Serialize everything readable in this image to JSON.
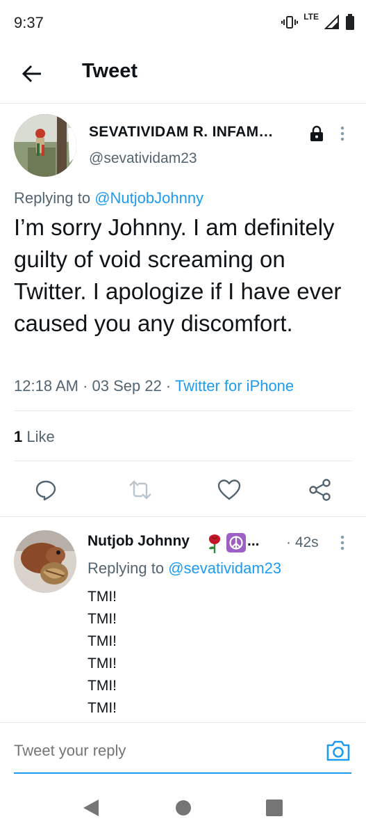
{
  "status_bar": {
    "time": "9:37",
    "network": "LTE"
  },
  "header": {
    "title": "Tweet"
  },
  "main_tweet": {
    "author_name": "SEVATIVIDAM R. INFAM…",
    "author_handle": "@sevatividam23",
    "protected": true,
    "replying_label": "Replying to ",
    "replying_mention": "@NutjobJohnny",
    "text": "I’m sorry Johnny. I am definitely guilty of void screaming on Twitter. I apologize if I have ever caused you any discomfort.",
    "meta_time": "12:18 AM · 03 Sep 22 · ",
    "meta_source": "Twitter for iPhone",
    "likes_count": "1",
    "likes_label": " Like"
  },
  "actions": [
    "reply-icon",
    "retweet-icon",
    "like-icon",
    "share-icon"
  ],
  "reply_tweet": {
    "author_name": "Nutjob Johnny",
    "name_ellipsis": "...",
    "time": "· 42s",
    "replying_label": "Replying to ",
    "replying_mention": "@sevatividam23",
    "lines": [
      "TMI!",
      "TMI!",
      "TMI!",
      "TMI!",
      "TMI!",
      "TMI!"
    ]
  },
  "composer": {
    "placeholder": "Tweet your reply"
  },
  "colors": {
    "accent": "#1d9bf0",
    "secondary_text": "#536471",
    "divider": "#e6ecf0"
  }
}
